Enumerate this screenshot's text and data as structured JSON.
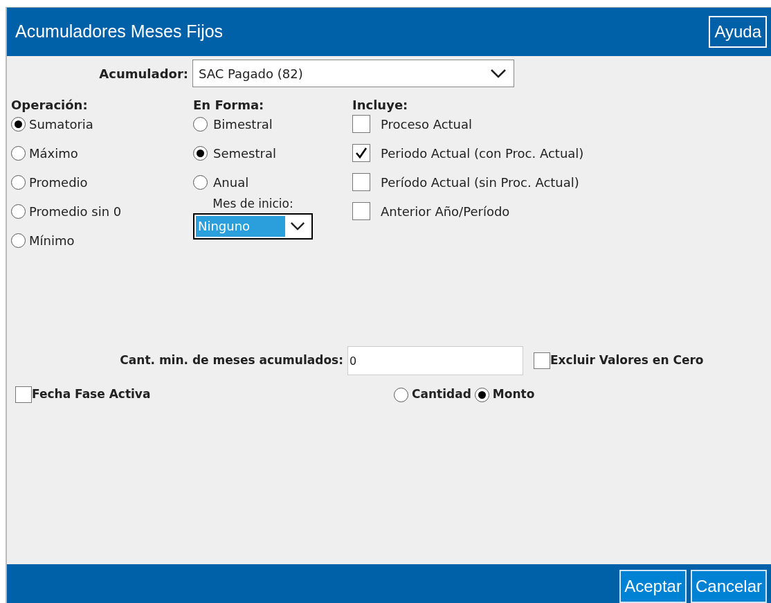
{
  "window": {
    "title": "Acumuladores Meses Fijos",
    "help_button": "Ayuda"
  },
  "acumulador": {
    "label": "Acumulador:",
    "value": "SAC Pagado (82)"
  },
  "operacion": {
    "label": "Operación:",
    "options": [
      {
        "label": "Sumatoria",
        "selected": true
      },
      {
        "label": "Máximo",
        "selected": false
      },
      {
        "label": "Promedio",
        "selected": false
      },
      {
        "label": "Promedio sin 0",
        "selected": false
      },
      {
        "label": "Mínimo",
        "selected": false
      }
    ]
  },
  "en_forma": {
    "label": "En Forma:",
    "options": [
      {
        "label": "Bimestral",
        "selected": false
      },
      {
        "label": "Semestral",
        "selected": true
      },
      {
        "label": "Anual",
        "selected": false
      }
    ]
  },
  "mes_inicio": {
    "label": "Mes de inicio:",
    "value": "Ninguno"
  },
  "incluye": {
    "label": "Incluye:",
    "items": [
      {
        "label": "Proceso Actual",
        "checked": false
      },
      {
        "label": "Periodo Actual (con Proc. Actual)",
        "checked": true
      },
      {
        "label": "Período Actual (sin Proc. Actual)",
        "checked": false
      },
      {
        "label": "Anterior Año/Período",
        "checked": false
      }
    ]
  },
  "cant_min": {
    "label": "Cant. min. de meses acumulados:",
    "value": "0"
  },
  "excluir_ceros": {
    "label": "Excluir Valores en Cero",
    "checked": false
  },
  "fecha_fase_activa": {
    "label": "Fecha Fase Activa",
    "checked": false
  },
  "tipo": {
    "options": [
      {
        "label": "Cantidad",
        "selected": false
      },
      {
        "label": "Monto",
        "selected": true
      }
    ]
  },
  "buttons": [
    "Aceptar",
    "Cancelar"
  ]
}
